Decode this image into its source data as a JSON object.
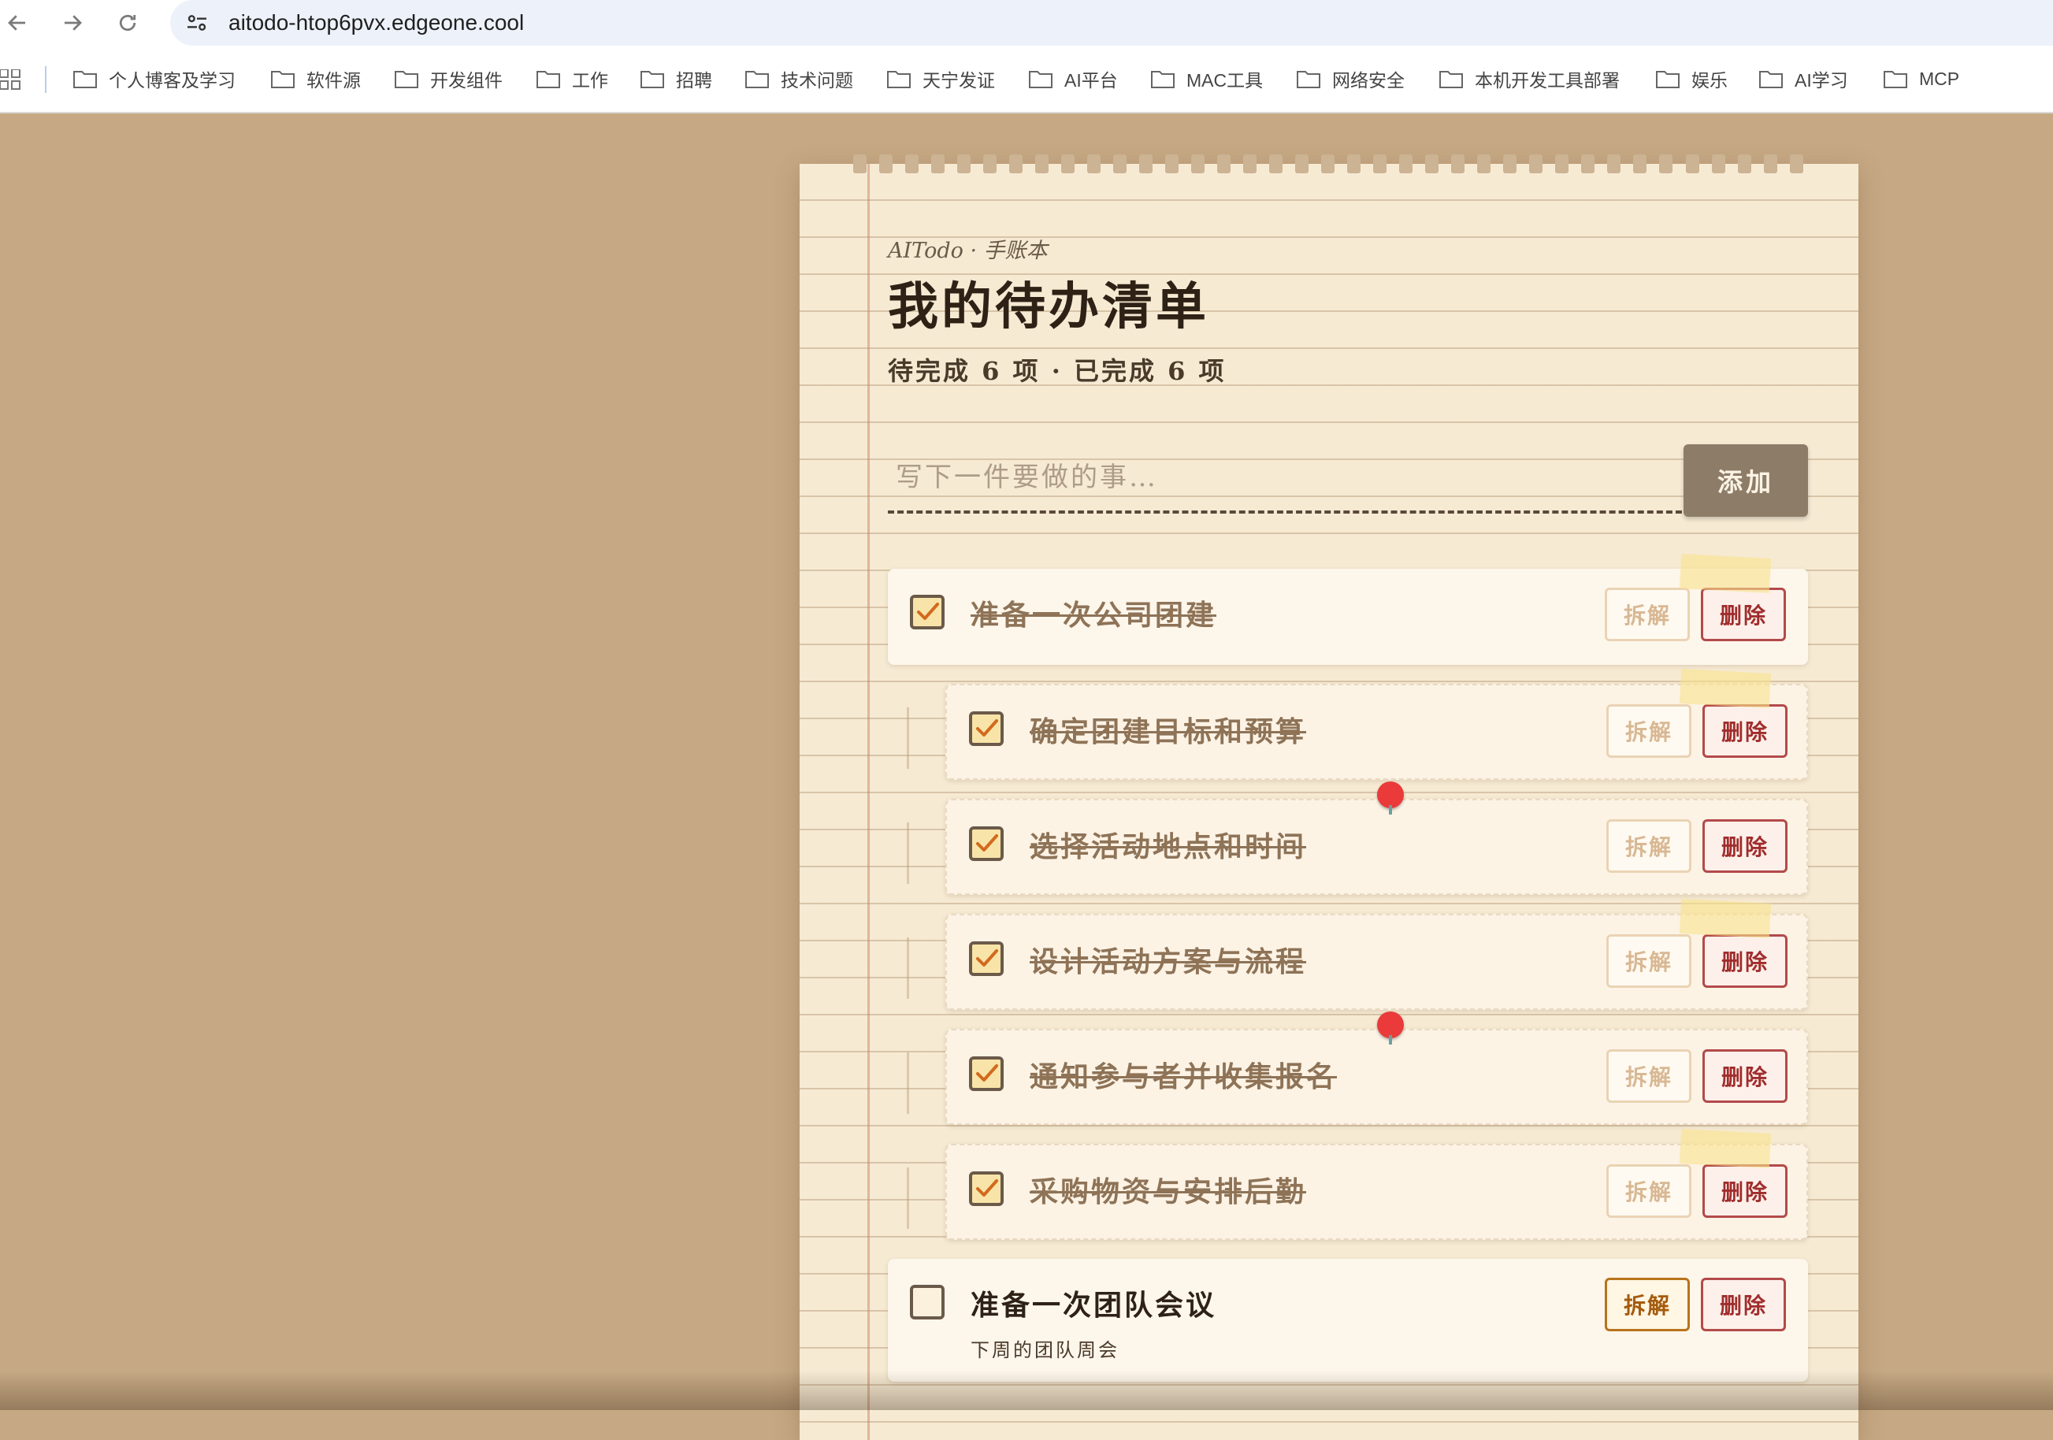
{
  "browser": {
    "url": "aitodo-htop6pvx.edgeone.cool",
    "back_icon": "arrow-left-icon",
    "forward_icon": "arrow-right-icon",
    "reload_icon": "reload-icon",
    "bookmarks": [
      "个人博客及学习",
      "软件源",
      "开发组件",
      "工作",
      "招聘",
      "技术问题",
      "天宁发证",
      "AI平台",
      "MAC工具",
      "网络安全",
      "本机开发工具部署",
      "娱乐",
      "AI学习",
      "MCP"
    ]
  },
  "app": {
    "brand": "AITodo · 手账本",
    "title": "我的待办清单",
    "stats": "待完成 6 项 · 已完成 6 项",
    "input_placeholder": "写下一件要做的事…",
    "add_label": "添加"
  },
  "tasks": [
    {
      "text": "准备一次公司团建",
      "done": true,
      "sub": false,
      "split_label": "拆解",
      "delete_label": "删除"
    },
    {
      "text": "确定团建目标和预算",
      "done": true,
      "sub": true,
      "split_label": "拆解",
      "delete_label": "删除"
    },
    {
      "text": "选择活动地点和时间",
      "done": true,
      "sub": true,
      "split_label": "拆解",
      "delete_label": "删除"
    },
    {
      "text": "设计活动方案与流程",
      "done": true,
      "sub": true,
      "split_label": "拆解",
      "delete_label": "删除"
    },
    {
      "text": "通知参与者并收集报名",
      "done": true,
      "sub": true,
      "split_label": "拆解",
      "delete_label": "删除"
    },
    {
      "text": "采购物资与安排后勤",
      "done": true,
      "sub": true,
      "split_label": "拆解",
      "delete_label": "删除"
    },
    {
      "text": "准备一次团队会议",
      "note": "下周的团队周会",
      "done": false,
      "sub": false,
      "split_label": "拆解",
      "delete_label": "删除"
    }
  ],
  "colors": {
    "desk": "#c6a984",
    "paper": "#f6ead3",
    "ink": "#2e2216",
    "done_ink": "#8e7357",
    "delete": "#b34a4a",
    "tape": "#f9e28c",
    "pin": "#ea3a3a"
  }
}
